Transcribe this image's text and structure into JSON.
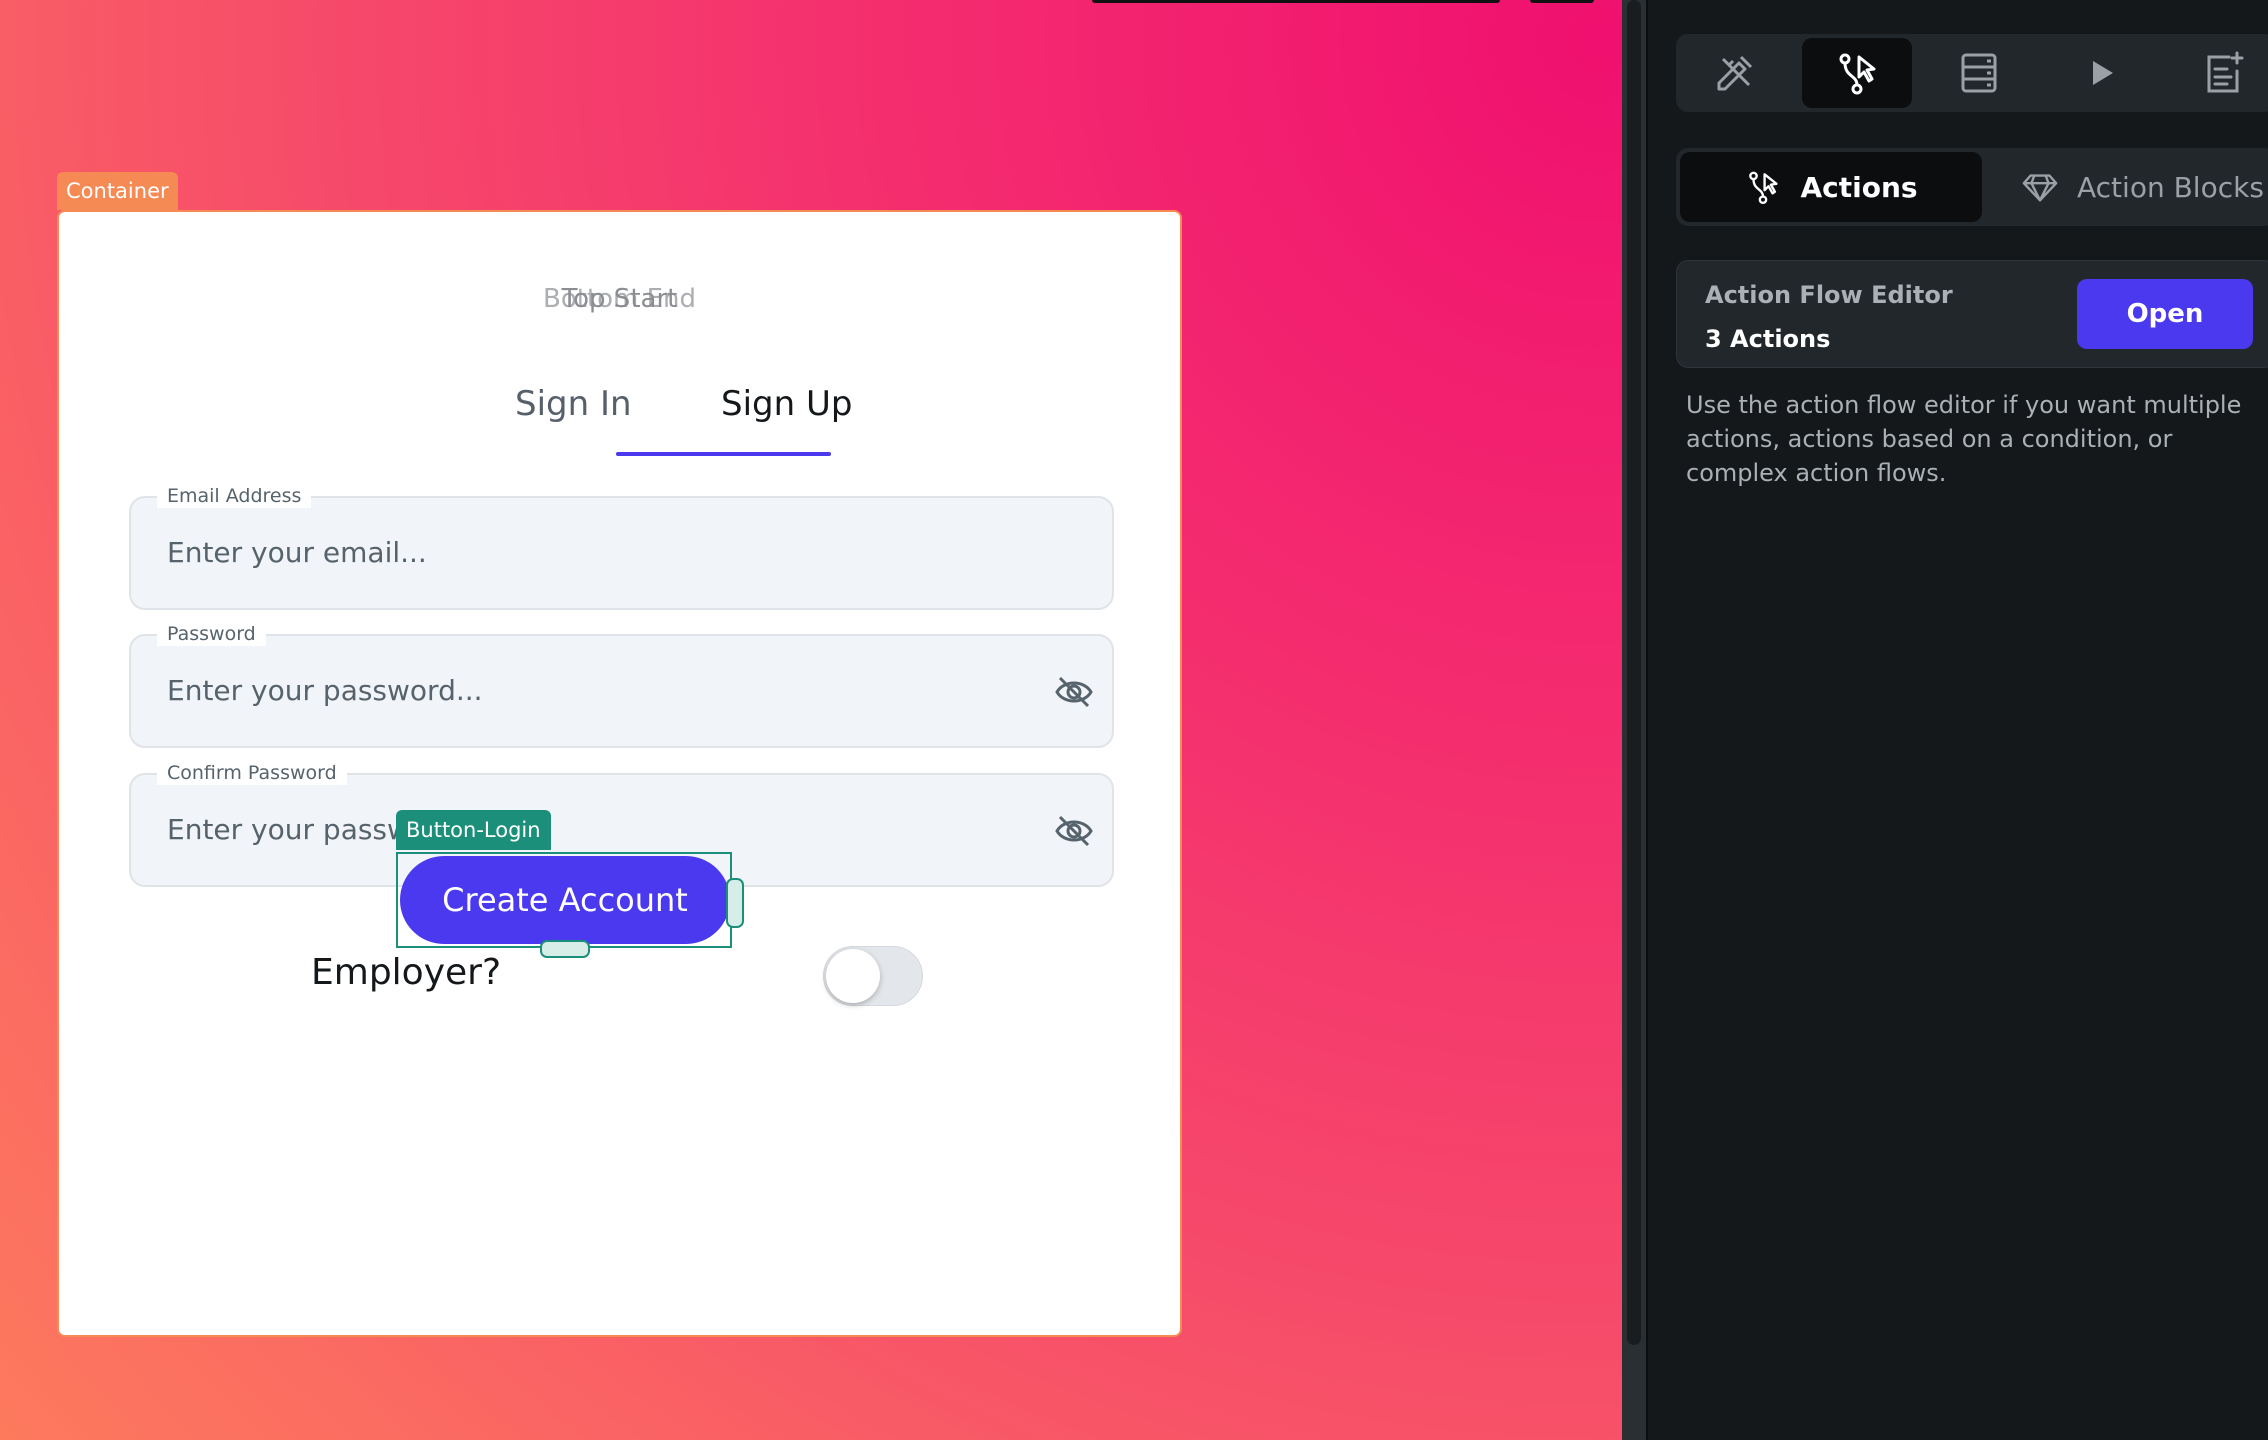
{
  "canvas": {
    "container_tag": "Container",
    "card": {
      "overlap_title": [
        "Top Start",
        "Bottom End"
      ],
      "tabs": [
        {
          "label": "Sign In"
        },
        {
          "label": "Sign Up"
        }
      ],
      "fields": [
        {
          "label": "Email Address",
          "placeholder": "Enter your email...",
          "icon": ""
        },
        {
          "label": "Password",
          "placeholder": "Enter your password...",
          "icon": "eye-off-icon"
        },
        {
          "label": "Confirm Password",
          "placeholder": "Enter your password...",
          "icon": "eye-off-icon"
        }
      ],
      "employer_label": "Employer?",
      "employer_toggle_on": false,
      "button_tag": "Button-Login",
      "button_label": "Create Account"
    }
  },
  "panel": {
    "icon_tabs": [
      {
        "icon": "design-icon"
      },
      {
        "icon": "actions-icon",
        "active": true
      },
      {
        "icon": "backend-query-icon"
      },
      {
        "icon": "play-icon"
      },
      {
        "icon": "page-add-icon"
      }
    ],
    "segments": [
      {
        "label": "Actions",
        "icon": "actions-icon",
        "active": true
      },
      {
        "label": "Action Blocks",
        "icon": "diamond-icon"
      }
    ],
    "action_flow": {
      "title": "Action Flow Editor",
      "count": "3 Actions",
      "open_label": "Open"
    },
    "help_text": "Use the action flow editor if you want multiple actions, actions based on a condition, or complex action flows."
  },
  "colors": {
    "primary": "#4b39ef",
    "selection_container": "#f68a55",
    "selection_widget": "#1b8f7a",
    "panel_bg": "#14181b"
  }
}
